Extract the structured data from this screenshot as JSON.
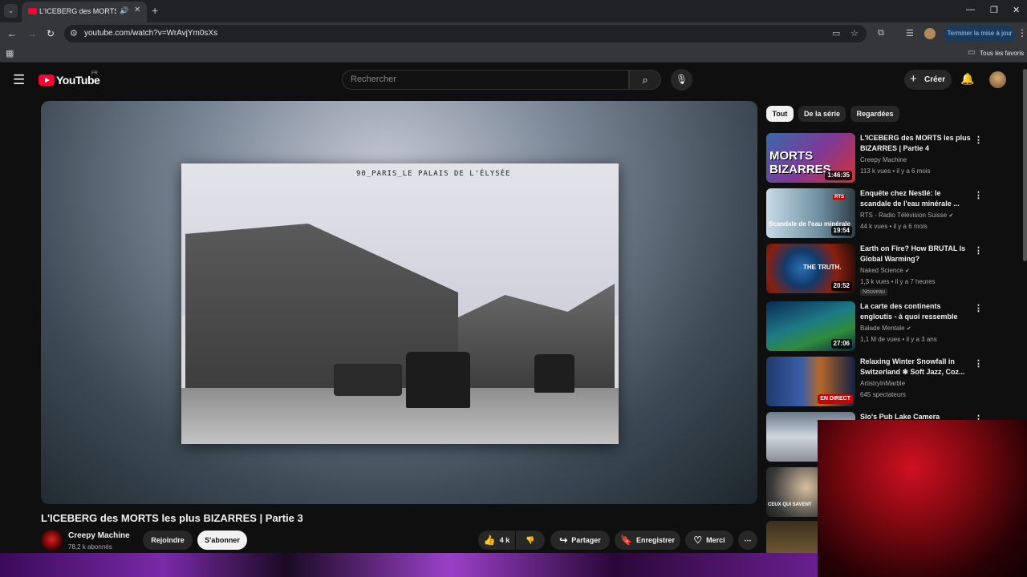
{
  "browser": {
    "tab_title": "L'ICEBERG des MORTS les p",
    "url": "youtube.com/watch?v=WrAvjYm0sXs",
    "update_button": "Terminer la mise à jour",
    "bookmarks_label": "Tous les favoris"
  },
  "youtube": {
    "logo_text": "YouTube",
    "country_code": "FR",
    "search_placeholder": "Rechercher",
    "create_label": "Créer"
  },
  "video": {
    "title": "L'ICEBERG des MORTS les plus BIZARRES | Partie 3",
    "postcard_caption": "90_PARIS_LE PALAIS DE L'ÉLYSÉE",
    "channel_name": "Creepy Machine",
    "subscribers": "78,2 k abonnés",
    "join_label": "Rejoindre",
    "subscribe_label": "S'abonner",
    "likes": "4 k",
    "share_label": "Partager",
    "save_label": "Enregistrer",
    "thanks_label": "Merci"
  },
  "chips": [
    "Tout",
    "De la série",
    "Regardées"
  ],
  "recommendations": [
    {
      "title": "L'ICEBERG des MORTS les plus BIZARRES | Partie 4",
      "channel": "Creepy Machine",
      "stats": "113 k vues • il y a 6 mois",
      "duration": "1:46:35",
      "thumb_text": "MORTS BIZARRES"
    },
    {
      "title": "Enquête chez Nestlé: le scandale de l'eau minérale ...",
      "channel": "RTS - Radio Télévision Suisse",
      "stats": "44 k vues • il y a 6 mois",
      "duration": "19:54",
      "thumb_text": "Scandale de l'eau minérale",
      "thumb_badge": "RTS"
    },
    {
      "title": "Earth on Fire? How BRUTAL Is Global Warming?",
      "channel": "Naked Science",
      "stats": "1,3 k vues • il y a 7 heures",
      "duration": "20:52",
      "thumb_text": "THE TRUTH.",
      "badge": "Nouveau"
    },
    {
      "title": "La carte des continents engloutis - à quoi ressemble la...",
      "channel": "Balade Mentale",
      "stats": "1,1 M de vues • il y a 3 ans",
      "duration": "27:06"
    },
    {
      "title": "Relaxing Winter Snowfall in Switzerland ❄ Soft Jazz, Coz...",
      "channel": "ArtistryInMarble",
      "stats": "645 spectateurs",
      "live_label": "EN DIRECT"
    },
    {
      "title": "Slo's Pub Lake Camera",
      "channel": "",
      "stats": ""
    },
    {
      "title": "",
      "channel": "",
      "stats": "",
      "thumb_text": "CEUX QUI SAVENT"
    },
    {
      "title": "",
      "channel": "",
      "stats": ""
    }
  ]
}
